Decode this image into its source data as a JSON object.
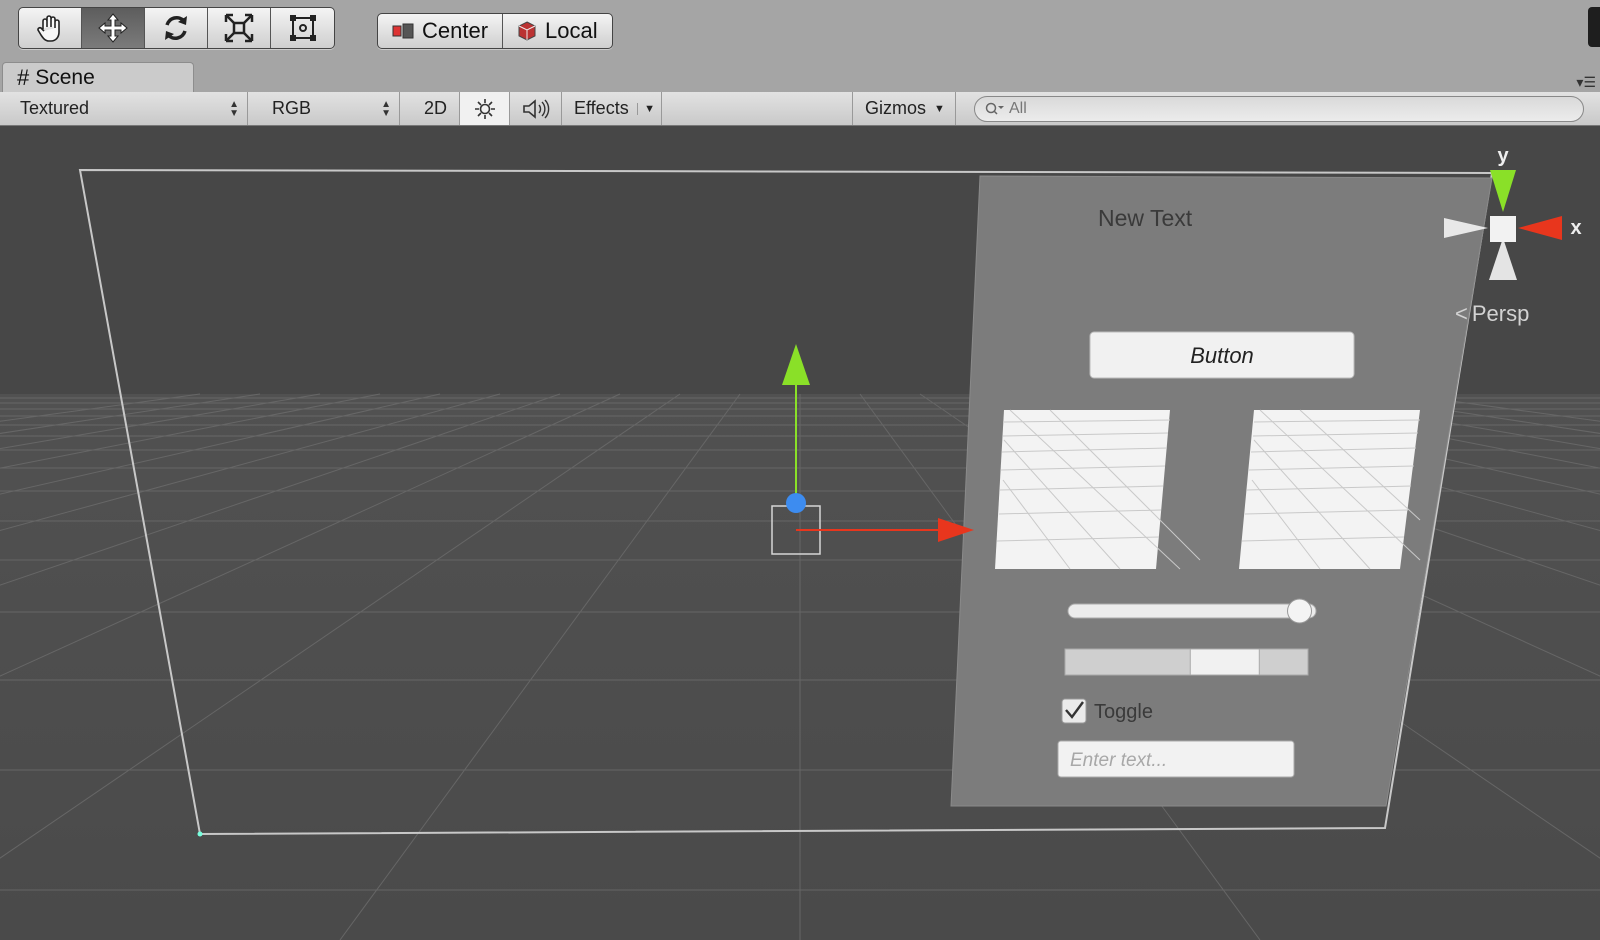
{
  "toolbar": {
    "transform_tools": [
      {
        "id": "hand",
        "icon": "hand-icon",
        "active": false
      },
      {
        "id": "move",
        "icon": "move-icon",
        "active": true
      },
      {
        "id": "rotate",
        "icon": "rotate-icon",
        "active": false
      },
      {
        "id": "scale",
        "icon": "scale-icon",
        "active": false
      },
      {
        "id": "rect",
        "icon": "rect-transform-icon",
        "active": false
      }
    ],
    "pivot_mode_label": "Center",
    "pivot_rotation_label": "Local"
  },
  "tabs": {
    "scene_label": "Scene"
  },
  "scene_toolbar": {
    "draw_mode": "Textured",
    "render_mode": "RGB",
    "mode_2d_label": "2D",
    "effects_label": "Effects",
    "gizmos_label": "Gizmos",
    "search_placeholder": "All"
  },
  "scene": {
    "canvas_text": "New Text",
    "button_label": "Button",
    "slider_value": 0.98,
    "scrollbar_value": 0.72,
    "toggle_label": "Toggle",
    "toggle_checked": true,
    "input_placeholder": "Enter text...",
    "orientation_gizmo": {
      "y_label": "y",
      "x_label": "x",
      "projection_label": "Persp"
    }
  },
  "colors": {
    "axis_x": "#e8361d",
    "axis_y": "#8ae028",
    "axis_z": "#3d8cf0",
    "viewport_bg": "#474747",
    "canvas_panel": "#7c7c7c"
  }
}
